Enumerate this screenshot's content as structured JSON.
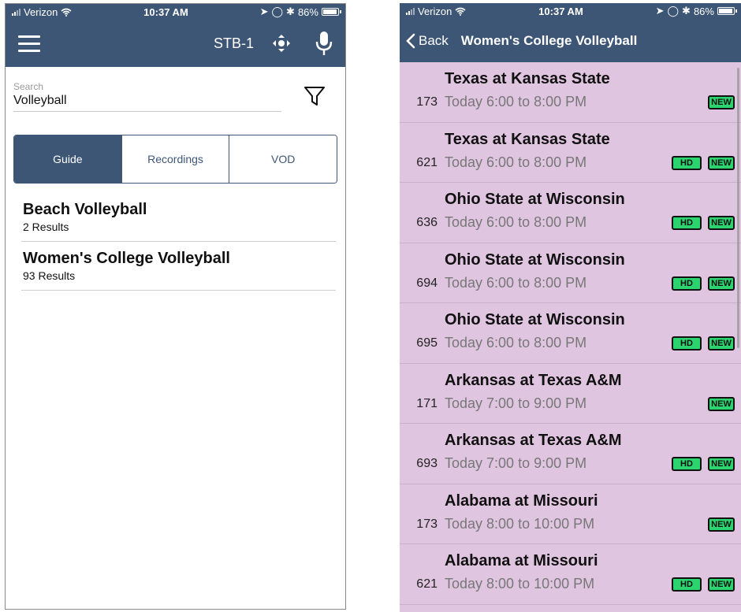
{
  "left_screen": {
    "status": {
      "carrier": "Verizon",
      "time": "10:37 AM",
      "battery": "86%"
    },
    "header": {
      "device_label": "STB-1"
    },
    "search": {
      "label": "Search",
      "value": "Volleyball"
    },
    "tabs": [
      {
        "label": "Guide",
        "active": true
      },
      {
        "label": "Recordings",
        "active": false
      },
      {
        "label": "VOD",
        "active": false
      }
    ],
    "results": [
      {
        "title": "Beach Volleyball",
        "count": "2 Results"
      },
      {
        "title": "Women's College Volleyball",
        "count": "93 Results"
      }
    ]
  },
  "right_screen": {
    "status": {
      "carrier": "Verizon",
      "time": "10:37 AM",
      "battery": "86%"
    },
    "header": {
      "back_label": "Back",
      "title": "Women's College Volleyball"
    },
    "badge_labels": {
      "hd": "HD",
      "new": "NEW"
    },
    "listings": [
      {
        "title": "Texas at Kansas State",
        "channel": "173",
        "time": "Today 6:00 to 8:00 PM",
        "hd": false,
        "new": true
      },
      {
        "title": "Texas at Kansas State",
        "channel": "621",
        "time": "Today 6:00 to 8:00 PM",
        "hd": true,
        "new": true
      },
      {
        "title": "Ohio State at Wisconsin",
        "channel": "636",
        "time": "Today 6:00 to 8:00 PM",
        "hd": true,
        "new": true
      },
      {
        "title": "Ohio State at Wisconsin",
        "channel": "694",
        "time": "Today 6:00 to 8:00 PM",
        "hd": true,
        "new": true
      },
      {
        "title": "Ohio State at Wisconsin",
        "channel": "695",
        "time": "Today 6:00 to 8:00 PM",
        "hd": true,
        "new": true
      },
      {
        "title": "Arkansas at Texas A&M",
        "channel": "171",
        "time": "Today 7:00 to 9:00 PM",
        "hd": false,
        "new": true
      },
      {
        "title": "Arkansas at Texas A&M",
        "channel": "693",
        "time": "Today 7:00 to 9:00 PM",
        "hd": true,
        "new": true
      },
      {
        "title": "Alabama at Missouri",
        "channel": "173",
        "time": "Today 8:00 to 10:00 PM",
        "hd": false,
        "new": true
      },
      {
        "title": "Alabama at Missouri",
        "channel": "621",
        "time": "Today 8:00 to 10:00 PM",
        "hd": true,
        "new": true
      }
    ]
  },
  "colors": {
    "nav": "#3e5675",
    "list_bg": "#e0c5e0",
    "badge_bg": "#2bd46e"
  },
  "icons": [
    "wifi-icon",
    "location-icon",
    "alarm-icon",
    "bluetooth-icon",
    "battery-icon",
    "hamburger-menu-icon",
    "dpad-icon",
    "microphone-icon",
    "filter-icon",
    "back-chevron-icon"
  ]
}
